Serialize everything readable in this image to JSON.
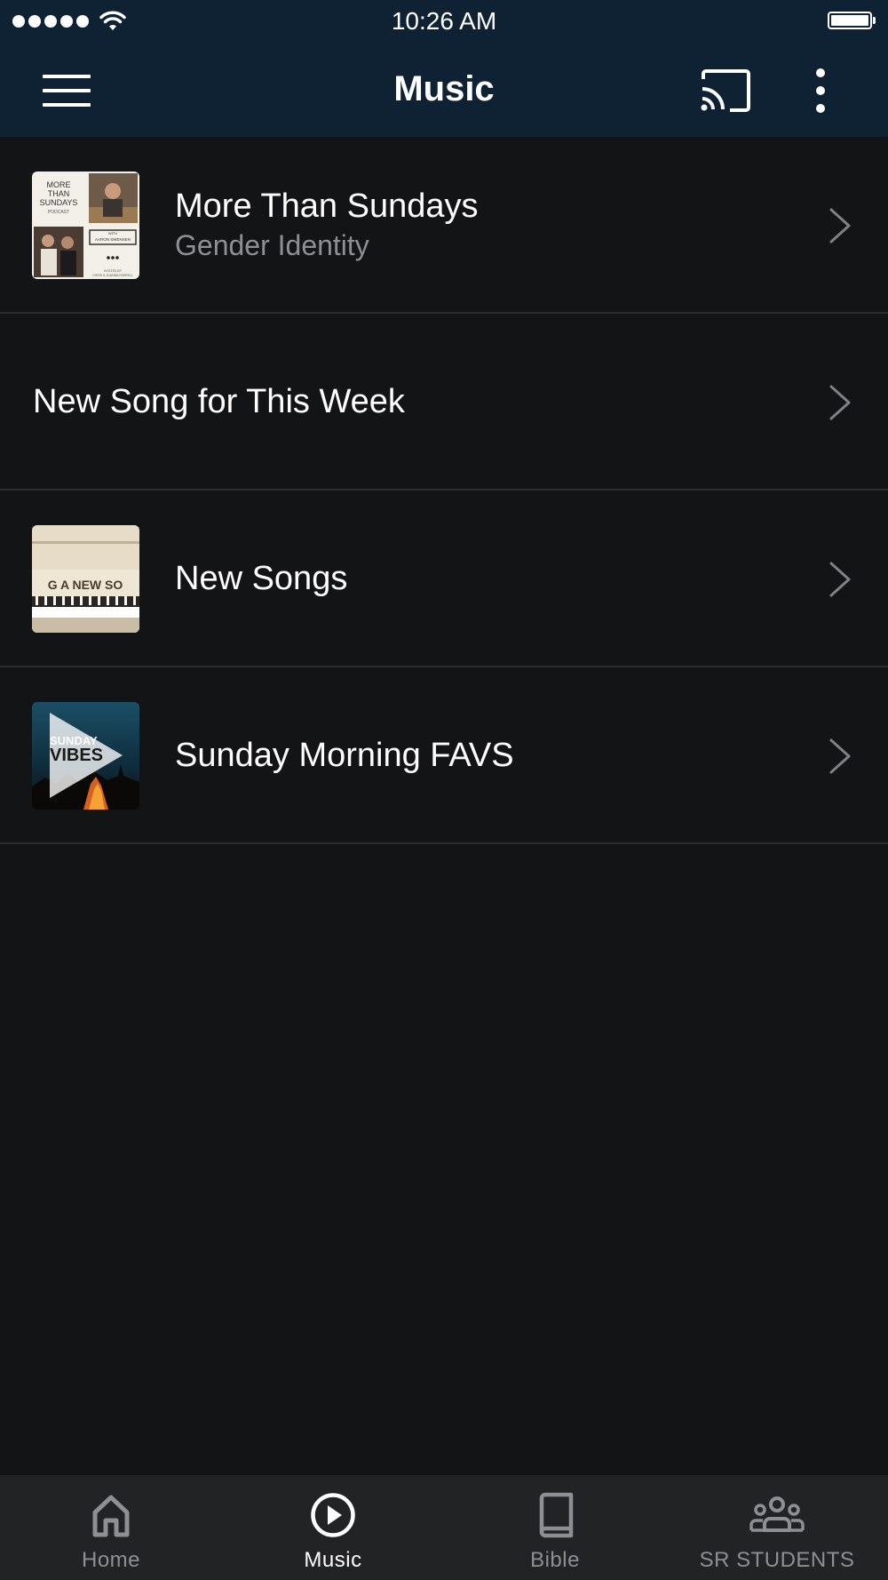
{
  "status_bar": {
    "time": "10:26 AM",
    "signal_bars": 5
  },
  "app_bar": {
    "title": "Music",
    "menu_icon": "hamburger-menu-icon",
    "cast_icon": "cast-icon",
    "more_icon": "more-vert-icon"
  },
  "list": {
    "items": [
      {
        "title": "More Than Sundays",
        "subtitle": "Gender Identity",
        "thumbnail": "more-than-sundays-podcast-thumbnail",
        "thumb_text": {
          "line1": "MORE",
          "line2": "THAN",
          "line3": "SUNDAYS",
          "line4": "PODCAST",
          "with": "WITH",
          "host": "AARON SWENSEN",
          "hosted": "HOSTED BY",
          "hosts": "CHRIS & JOANNA FARRELL"
        }
      },
      {
        "title": "New Song for This Week",
        "subtitle": "",
        "thumbnail": ""
      },
      {
        "title": "New Songs",
        "subtitle": "",
        "thumbnail": "piano-new-songs-thumbnail",
        "thumb_text": "G A NEW SO"
      },
      {
        "title": "Sunday Morning FAVS",
        "subtitle": "",
        "thumbnail": "sunday-vibes-thumbnail",
        "thumb_text": {
          "line1": "SUNDAY",
          "line2": "VIBES"
        }
      }
    ]
  },
  "bottom_nav": {
    "items": [
      {
        "label": "Home",
        "icon": "home-icon",
        "active": false
      },
      {
        "label": "Music",
        "icon": "play-circle-icon",
        "active": true
      },
      {
        "label": "Bible",
        "icon": "book-icon",
        "active": false
      },
      {
        "label": "SR STUDENTS",
        "icon": "group-icon",
        "active": false
      }
    ]
  },
  "colors": {
    "header_bg": "#0f2234",
    "body_bg": "#131416",
    "nav_bg": "#222325",
    "subtitle": "#8d8f93",
    "divider": "#2a2c30"
  }
}
